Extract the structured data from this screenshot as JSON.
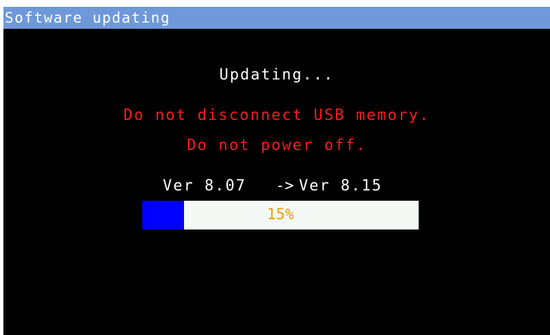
{
  "window": {
    "title": "Software updating"
  },
  "status": {
    "text": "Updating..."
  },
  "warnings": {
    "line1": "Do not disconnect USB memory.",
    "line2": "Do not power off."
  },
  "version": {
    "from": "Ver 8.07",
    "arrow": "->",
    "to": "Ver 8.15"
  },
  "progress": {
    "label": "15%",
    "value_fraction": 0.15
  },
  "colors": {
    "title_bar": "#6f98da",
    "background": "#000000",
    "warning_text": "#ff1a1a",
    "progress_fill": "#0000ff",
    "progress_track": "#f5f9f5",
    "progress_text": "#ef9a10"
  }
}
